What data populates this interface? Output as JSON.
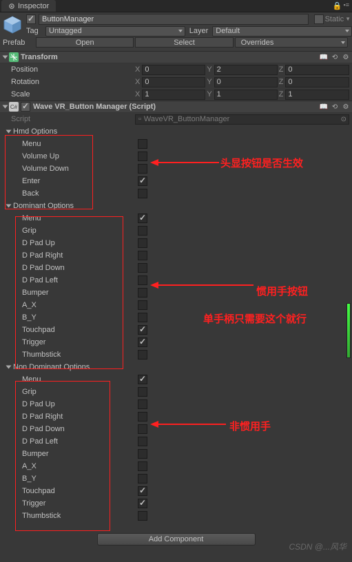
{
  "tab": {
    "title": "Inspector"
  },
  "gameObject": {
    "name": "ButtonManager",
    "static_label": "Static",
    "tag_label": "Tag",
    "tag_value": "Untagged",
    "layer_label": "Layer",
    "layer_value": "Default",
    "prefab_label": "Prefab",
    "prefab_open": "Open",
    "prefab_select": "Select",
    "prefab_overrides": "Overrides"
  },
  "transform": {
    "title": "Transform",
    "position_label": "Position",
    "rotation_label": "Rotation",
    "scale_label": "Scale",
    "axes": {
      "x": "X",
      "y": "Y",
      "z": "Z"
    },
    "position": {
      "x": "0",
      "y": "2",
      "z": "0"
    },
    "rotation": {
      "x": "0",
      "y": "0",
      "z": "0"
    },
    "scale": {
      "x": "1",
      "y": "1",
      "z": "1"
    }
  },
  "script": {
    "title": "Wave VR_Button Manager (Script)",
    "field_label": "Script",
    "field_value": "WaveVR_ButtonManager"
  },
  "sections": {
    "hmd": {
      "title": "Hmd Options",
      "items": [
        {
          "label": "Menu",
          "checked": false
        },
        {
          "label": "Volume Up",
          "checked": false
        },
        {
          "label": "Volume Down",
          "checked": false
        },
        {
          "label": "Enter",
          "checked": true
        },
        {
          "label": "Back",
          "checked": false
        }
      ]
    },
    "dominant": {
      "title": "Dominant Options",
      "items": [
        {
          "label": "Menu",
          "checked": true
        },
        {
          "label": "Grip",
          "checked": false
        },
        {
          "label": "D Pad Up",
          "checked": false
        },
        {
          "label": "D Pad Right",
          "checked": false
        },
        {
          "label": "D Pad Down",
          "checked": false
        },
        {
          "label": "D Pad Left",
          "checked": false
        },
        {
          "label": "Bumper",
          "checked": false
        },
        {
          "label": "A_X",
          "checked": false
        },
        {
          "label": "B_Y",
          "checked": false
        },
        {
          "label": "Touchpad",
          "checked": true
        },
        {
          "label": "Trigger",
          "checked": true
        },
        {
          "label": "Thumbstick",
          "checked": false
        }
      ]
    },
    "nonDominant": {
      "title": "Non Dominant Options",
      "items": [
        {
          "label": "Menu",
          "checked": true
        },
        {
          "label": "Grip",
          "checked": false
        },
        {
          "label": "D Pad Up",
          "checked": false
        },
        {
          "label": "D Pad Right",
          "checked": false
        },
        {
          "label": "D Pad Down",
          "checked": false
        },
        {
          "label": "D Pad Left",
          "checked": false
        },
        {
          "label": "Bumper",
          "checked": false
        },
        {
          "label": "A_X",
          "checked": false
        },
        {
          "label": "B_Y",
          "checked": false
        },
        {
          "label": "Touchpad",
          "checked": true
        },
        {
          "label": "Trigger",
          "checked": true
        },
        {
          "label": "Thumbstick",
          "checked": false
        }
      ]
    }
  },
  "annotations": {
    "hmd": "头显按钮是否生效",
    "dominant1": "惯用手按钮",
    "dominant2": "单手柄只需要这个就行",
    "nondominant": "非惯用手"
  },
  "footer": {
    "add_component": "Add Component",
    "watermark": "CSDN @...风华"
  }
}
